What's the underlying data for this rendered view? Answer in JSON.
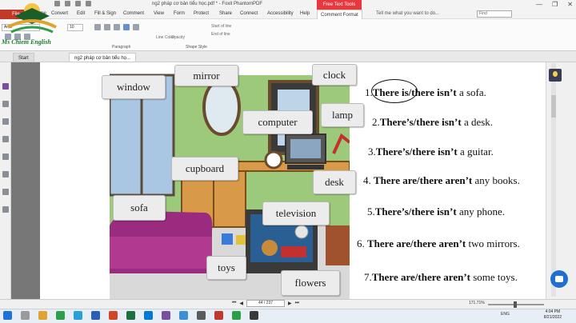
{
  "window": {
    "title": "ng2 pháp cơ bản tiểu học.pdf * - Foxit PhantomPDF",
    "context_tab": "Free Text Tools",
    "controls": [
      "—",
      "❐",
      "✕"
    ]
  },
  "logo": {
    "text": "Ms Chiem English"
  },
  "ribbon": {
    "file_tab": "File",
    "tabs": [
      "Home",
      "Convert",
      "Edit",
      "Fill & Sign",
      "Comment",
      "View",
      "Form",
      "Protect",
      "Share",
      "Connect",
      "Accessibility",
      "Help",
      "Comment Format"
    ],
    "active_tab": "Comment Format",
    "tell_me": "Tell me what you want to do...",
    "find_placeholder": "Find",
    "font_name": "Arial",
    "font_size": "10",
    "groups": [
      "Paragraph",
      "Shape Style"
    ],
    "line_color": "Line Color",
    "opacity": "Opacity",
    "start_of_line": "Start of line",
    "end_of_line": "End of line"
  },
  "doc_tabs": [
    {
      "label": "Start",
      "active": false
    },
    {
      "label": "ng2 pháp cơ bản tiểu họ...",
      "active": true
    }
  ],
  "illustration": {
    "labels": [
      "window",
      "mirror",
      "clock",
      "computer",
      "lamp",
      "cupboard",
      "desk",
      "sofa",
      "television",
      "toys",
      "flowers"
    ]
  },
  "sentences": [
    {
      "num": "1.",
      "bold": "There is/there isn’t",
      "rest": "a sofa."
    },
    {
      "num": "2.",
      "bold": "There’s/there isn’t",
      "rest": "a desk."
    },
    {
      "num": "3.",
      "bold": "There’s/there isn’t",
      "rest": "a guitar."
    },
    {
      "num": "4.",
      "bold": "There are/there aren’t",
      "rest": "any books."
    },
    {
      "num": "5.",
      "bold": "There’s/there isn’t",
      "rest": "any phone."
    },
    {
      "num": "6.",
      "bold": "There are/there aren’t",
      "rest": "two mirrors."
    },
    {
      "num": "7.",
      "bold": "There are/there aren’t",
      "rest": "some toys."
    }
  ],
  "status": {
    "page_box": "44 / 237",
    "zoom": "171.71%"
  },
  "taskbar": {
    "lang": "ENG",
    "time": "4:04 PM",
    "date": "8/21/2022"
  },
  "colors": {
    "file_tab": "#c0392b",
    "context_tab": "#e8383d",
    "room_wall": "#9cc97a",
    "sofa": "#9b2b7e"
  }
}
